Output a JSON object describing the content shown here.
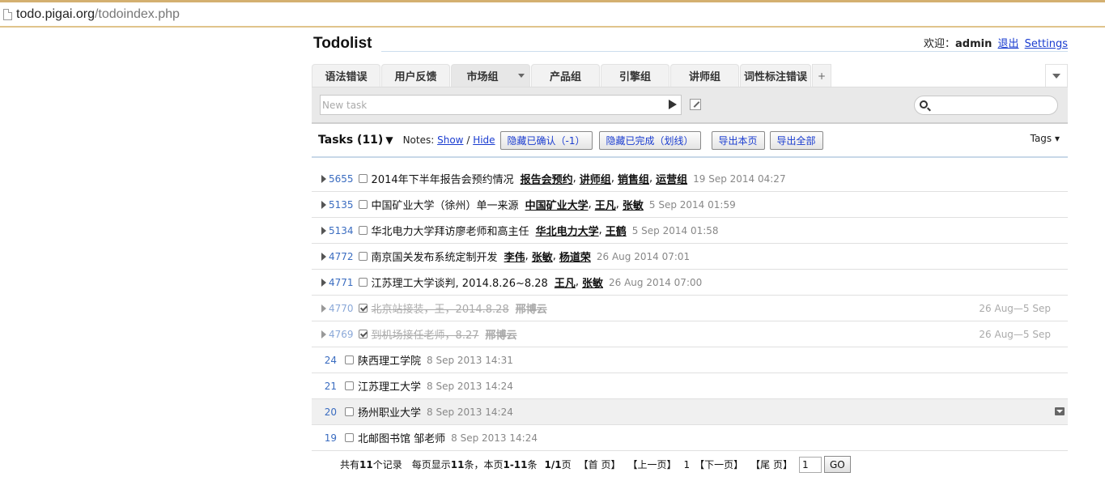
{
  "browser": {
    "url_domain": "todo.pigai.org",
    "url_path": "/todoindex.php"
  },
  "header": {
    "title": "Todolist",
    "welcome": "欢迎：",
    "username": "admin",
    "logout": "退出",
    "settings": "Settings"
  },
  "tabs": [
    {
      "label": "语法错误",
      "w": 85
    },
    {
      "label": "用户反馈",
      "w": 85
    },
    {
      "label": "市场组",
      "w": 98,
      "active": true
    },
    {
      "label": "产品组",
      "w": 85
    },
    {
      "label": "引擎组",
      "w": 85
    },
    {
      "label": "讲师组",
      "w": 85
    },
    {
      "label": "词性标注错误",
      "w": 88
    }
  ],
  "newtask": {
    "placeholder": "New task",
    "search_placeholder": ""
  },
  "toolbar": {
    "tasks_label": "Tasks (11)",
    "tasks_arrow": "▼",
    "notes_label": "Notes:",
    "show": "Show",
    "slash": "/",
    "hide": "Hide",
    "btn_hide_confirmed": "隐藏已确认（-1）",
    "btn_hide_completed": "隐藏已完成（划线）",
    "btn_export_page": "导出本页",
    "btn_export_all": "导出全部",
    "tags": "Tags ▾"
  },
  "tasks": [
    {
      "id": "5655",
      "expand": true,
      "done": false,
      "text": "2014年下半年报告会预约情况",
      "tags": [
        "报告会预约",
        "讲师组",
        "销售组",
        "运营组"
      ],
      "date": "19 Sep 2014 04:27",
      "span": ""
    },
    {
      "id": "5135",
      "expand": true,
      "done": false,
      "text": "中国矿业大学（徐州）单一来源",
      "tags": [
        "中国矿业大学",
        "王凡",
        "张敏"
      ],
      "date": "5 Sep 2014 01:59",
      "span": ""
    },
    {
      "id": "5134",
      "expand": true,
      "done": false,
      "text": "华北电力大学拜访廖老师和高主任",
      "tags": [
        "华北电力大学",
        "王鹤"
      ],
      "date": "5 Sep 2014 01:58",
      "span": ""
    },
    {
      "id": "4772",
      "expand": true,
      "done": false,
      "text": "南京国关发布系统定制开发",
      "tags": [
        "李伟",
        "张敏",
        "杨道荣"
      ],
      "date": "26 Aug 2014 07:01",
      "span": ""
    },
    {
      "id": "4771",
      "expand": true,
      "done": false,
      "text": "江苏理工大学谈判, 2014.8.26~8.28",
      "tags": [
        "王凡",
        "张敏"
      ],
      "date": "26 Aug 2014 07:00",
      "span": ""
    },
    {
      "id": "4770",
      "expand": true,
      "done": true,
      "text": "北京站接装，王，2014.8.28",
      "tags": [
        "邢博云"
      ],
      "date": "",
      "span": "26 Aug—5 Sep"
    },
    {
      "id": "4769",
      "expand": true,
      "done": true,
      "text": "到机场接任老师，8.27",
      "tags": [
        "邢博云"
      ],
      "date": "",
      "span": "26 Aug—5 Sep"
    },
    {
      "id": "24",
      "expand": false,
      "done": false,
      "text": "陕西理工学院",
      "tags": [],
      "date": "8 Sep 2013 14:31",
      "span": ""
    },
    {
      "id": "21",
      "expand": false,
      "done": false,
      "text": "江苏理工大学",
      "tags": [],
      "date": "8 Sep 2013 14:24",
      "span": ""
    },
    {
      "id": "20",
      "expand": false,
      "done": false,
      "text": "扬州职业大学",
      "tags": [],
      "date": "8 Sep 2013 14:24",
      "span": "",
      "highlight": true
    },
    {
      "id": "19",
      "expand": false,
      "done": false,
      "text": "北邮图书馆 邹老师",
      "tags": [],
      "date": "8 Sep 2013 14:24",
      "span": ""
    }
  ],
  "pager": {
    "total_prefix": "共有",
    "total": "11",
    "total_suffix": "个记录",
    "per_prefix": "每页显示",
    "per": "11",
    "per_suffix": "条，本页",
    "range": "1-11",
    "range_suffix": "条",
    "pages": "1/1",
    "pages_suffix": "页",
    "first": "【首 页】",
    "prev": "【上一页】",
    "current": "1",
    "next": "【下一页】",
    "last": "【尾 页】",
    "input_value": "1",
    "go": "GO"
  }
}
